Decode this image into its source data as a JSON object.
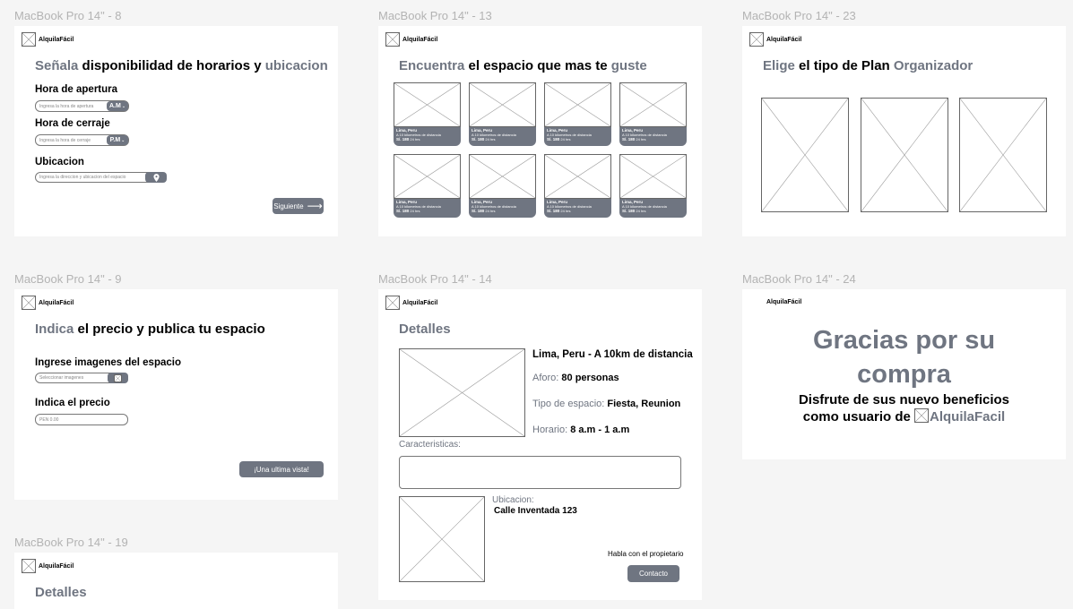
{
  "brand": "AlquilaFácil",
  "frames": {
    "f8": {
      "title": "MacBook Pro 14\" - 8",
      "heading_accent1": "Señala",
      "heading_mid": " disponibilidad de horarios y ",
      "heading_accent2": "ubicacion",
      "open_label": "Hora de apertura",
      "open_placeholder": "Ingresa la hora de apertura",
      "open_period": "A.M",
      "close_label": "Hora de cerraje",
      "close_placeholder": "Ingresa la hora de cerraje",
      "close_period": "P.M",
      "loc_label": "Ubicacion",
      "loc_placeholder": "Ingresa la direccion y ubicacion del espacio",
      "next_button": "Siguiente"
    },
    "f13": {
      "title": "MacBook Pro 14\" - 13",
      "heading_accent1": "Encuentra",
      "heading_mid": " el espacio que mas te ",
      "heading_accent2": "guste",
      "card_city": "Lima, Peru",
      "card_distance": "A 10 kilometros de distancia",
      "card_price": "S/. 180",
      "card_hours": "24 hrs"
    },
    "f23": {
      "title": "MacBook Pro 14\" - 23",
      "heading_accent1": "Elige",
      "heading_mid": " el tipo de Plan ",
      "heading_accent2": "Organizador"
    },
    "f9": {
      "title": "MacBook Pro 14\" - 9",
      "heading_accent1": "Indica",
      "heading_mid": " el precio y publica tu espacio",
      "images_label": "Ingrese imagenes del espacio",
      "images_placeholder": "Seleccionar imagenes",
      "price_label": "Indica el precio",
      "price_placeholder": "PEN 0.00",
      "last_view_button": "¡Una ultima vista!"
    },
    "f14": {
      "title": "MacBook Pro 14\" - 14",
      "heading": "Detalles",
      "location": "Lima, Peru - A 10km de distancia",
      "aforo_label": "Aforo: ",
      "aforo_value": "80 personas",
      "tipo_label": "Tipo de espacio: ",
      "tipo_value": "Fiesta, Reunion",
      "horario_label": "Horario: ",
      "horario_value": "8 a.m - 1 a.m",
      "caracteristicas": "Caracteristicas:",
      "ubicacion_label": "Ubicacion:",
      "ubicacion_value": "Calle Inventada 123",
      "owner_text": "Habla con el propietario",
      "contact_button": "Contacto"
    },
    "f24": {
      "title": "MacBook Pro 14\" - 24",
      "thanks": "Gracias por su compra",
      "enjoy_line1": "Disfrute de sus nuevo beneficios",
      "enjoy_line2": "como usuario de ",
      "enjoy_brand": "AlquilaFacil"
    },
    "f19": {
      "title": "MacBook Pro 14\" - 19",
      "heading": "Detalles"
    }
  }
}
